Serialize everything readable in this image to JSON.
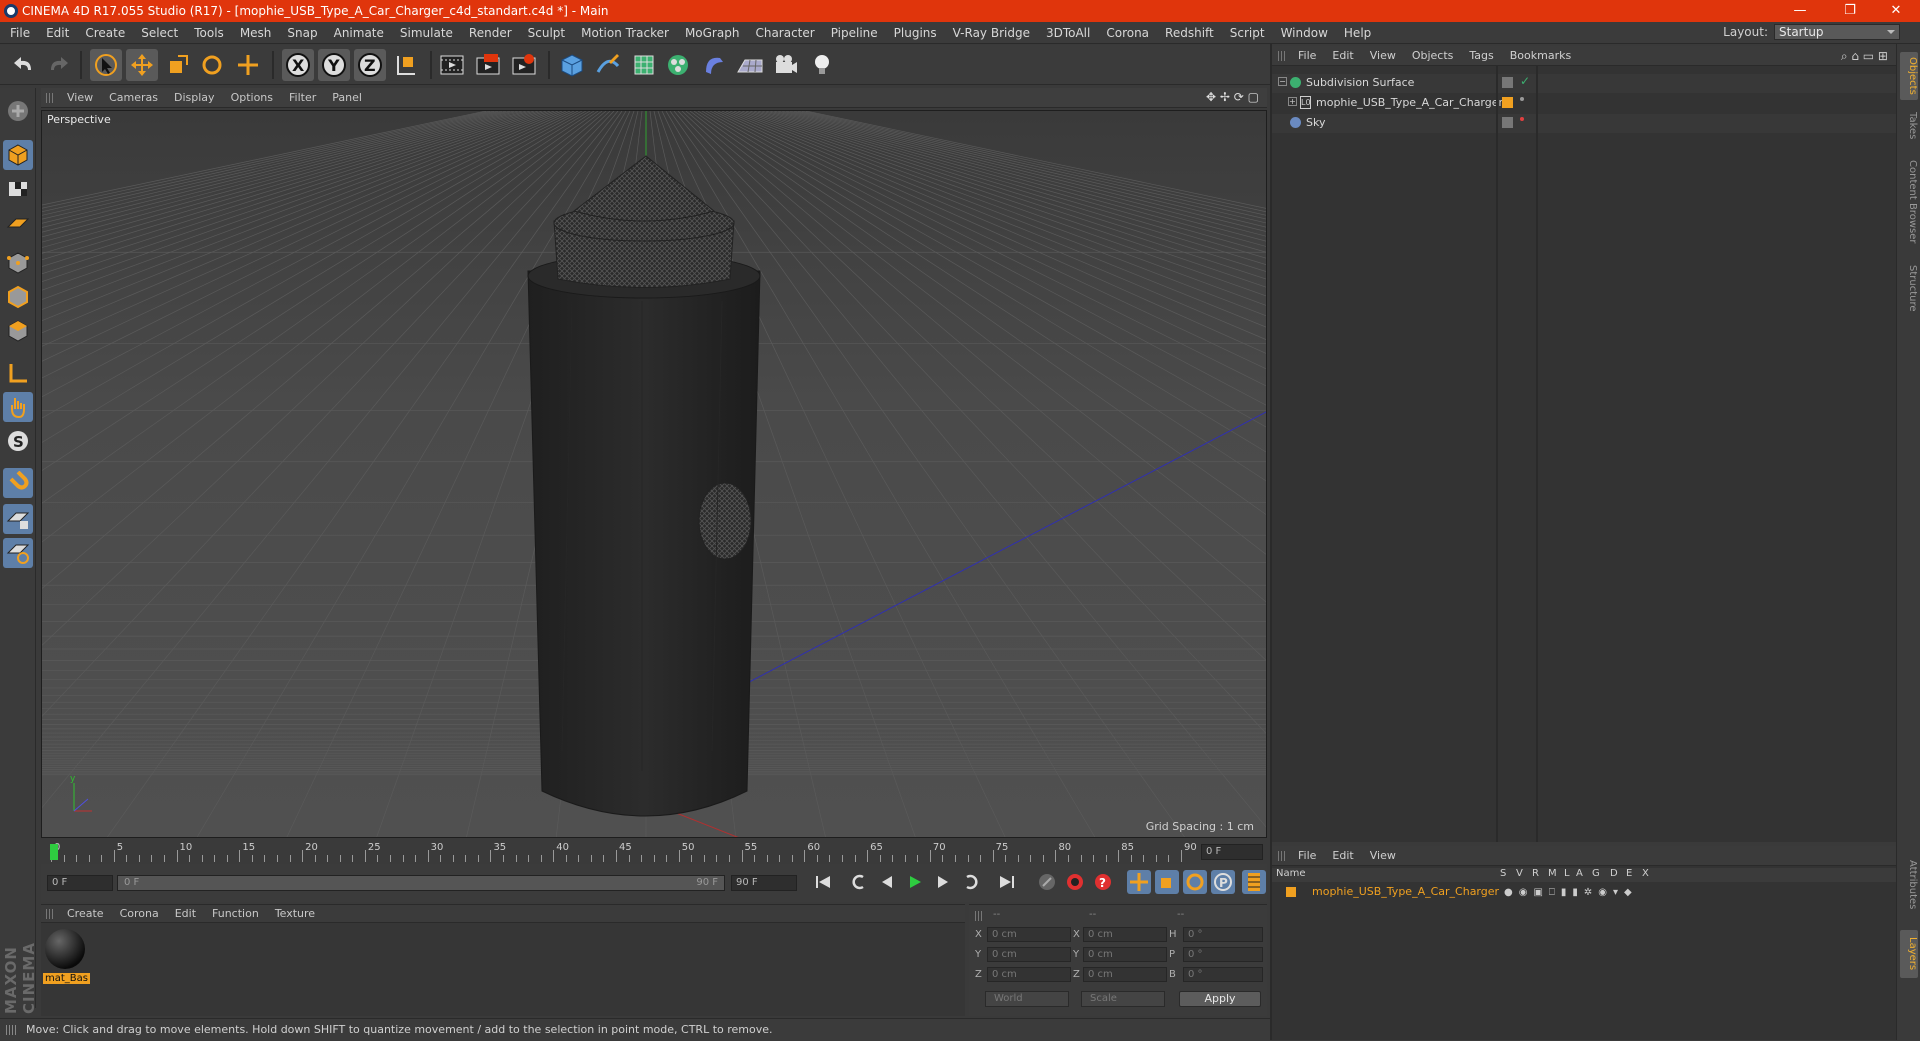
{
  "window": {
    "title": "CINEMA 4D R17.055 Studio (R17) - [mophie_USB_Type_A_Car_Charger_c4d_standart.c4d *] - Main",
    "minimize": "—",
    "restore": "❐",
    "close": "✕"
  },
  "menubar": [
    "File",
    "Edit",
    "Create",
    "Select",
    "Tools",
    "Mesh",
    "Snap",
    "Animate",
    "Simulate",
    "Render",
    "Sculpt",
    "Motion Tracker",
    "MoGraph",
    "Character",
    "Pipeline",
    "Plugins",
    "V-Ray Bridge",
    "3DToAll",
    "Corona",
    "Redshift",
    "Script",
    "Window",
    "Help"
  ],
  "layout": {
    "label": "Layout:",
    "value": "Startup"
  },
  "viewport": {
    "menu": [
      "View",
      "Cameras",
      "Display",
      "Options",
      "Filter",
      "Panel"
    ],
    "label": "Perspective",
    "grid_spacing": "Grid Spacing : 1 cm"
  },
  "timeline": {
    "ticks": [
      "0",
      "5",
      "10",
      "15",
      "20",
      "25",
      "30",
      "35",
      "40",
      "45",
      "50",
      "55",
      "60",
      "65",
      "70",
      "75",
      "80",
      "85",
      "90"
    ],
    "current_frame": "0 F",
    "start_field": "0 F",
    "range_start": "0 F",
    "range_end": "90 F",
    "end_field": "90 F"
  },
  "material_panel": {
    "menu": [
      "Create",
      "Corona",
      "Edit",
      "Function",
      "Texture"
    ],
    "materials": [
      {
        "name": "mat_Bas"
      }
    ]
  },
  "coord_panel": {
    "headers": [
      "--",
      "--",
      "--"
    ],
    "rows": [
      {
        "axis": "X",
        "pos": "0 cm",
        "axis2": "X",
        "size": "0 cm",
        "rot_label": "H",
        "rot": "0 °"
      },
      {
        "axis": "Y",
        "pos": "0 cm",
        "axis2": "Y",
        "size": "0 cm",
        "rot_label": "P",
        "rot": "0 °"
      },
      {
        "axis": "Z",
        "pos": "0 cm",
        "axis2": "Z",
        "size": "0 cm",
        "rot_label": "B",
        "rot": "0 °"
      }
    ],
    "space": "World",
    "mode": "Scale",
    "apply": "Apply"
  },
  "status": "Move: Click and drag to move elements. Hold down SHIFT to quantize movement / add to the selection in point mode, CTRL to remove.",
  "object_panel": {
    "menu": [
      "File",
      "Edit",
      "View",
      "Objects",
      "Tags",
      "Bookmarks"
    ],
    "objects": [
      {
        "name": "Subdivision Surface"
      },
      {
        "name": "mophie_USB_Type_A_Car_Charger"
      },
      {
        "name": "Sky"
      }
    ]
  },
  "layer_panel": {
    "menu": [
      "File",
      "Edit",
      "View"
    ],
    "columns": [
      "Name",
      "S",
      "V",
      "R",
      "M",
      "L",
      "A",
      "G",
      "D",
      "E",
      "X"
    ],
    "layers": [
      {
        "name": "mophie_USB_Type_A_Car_Charger",
        "color": "#f0a020"
      }
    ]
  },
  "side_tabs": [
    "Objects",
    "Takes",
    "Content Browser",
    "Structure",
    "Attributes",
    "Layers"
  ],
  "brand": "MAXON CINEMA 4D",
  "colors": {
    "title_bar": "#e0350c",
    "accent": "#f0a020",
    "active_tool": "#5e7fa8"
  }
}
